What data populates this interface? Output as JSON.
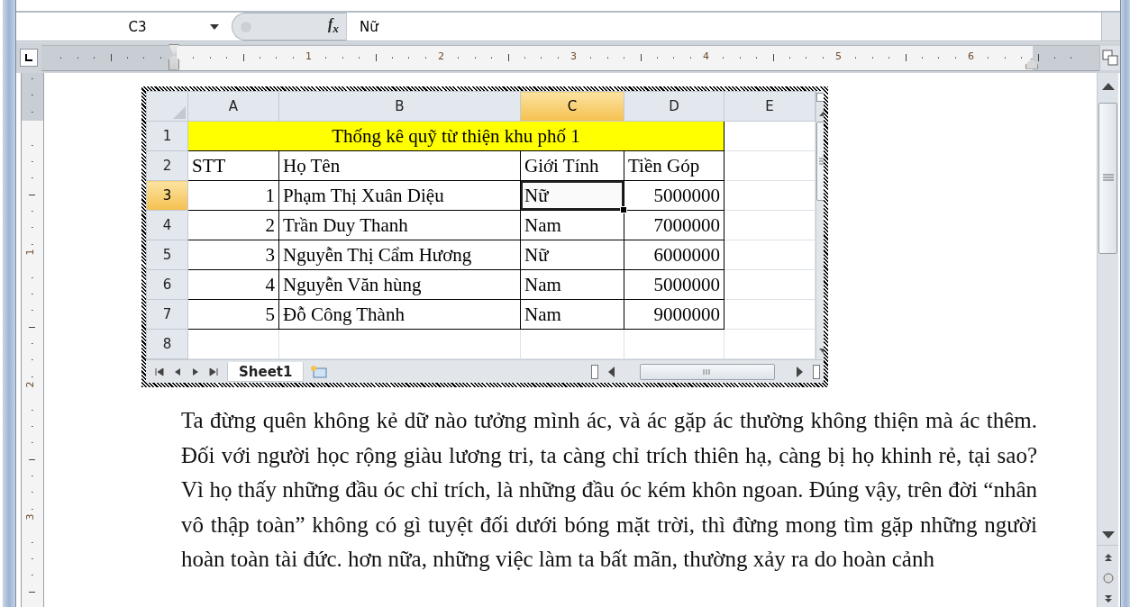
{
  "formula_bar": {
    "name_box": "C3",
    "function_label": "f$_{x}$",
    "value": "Nữ"
  },
  "ruler": {
    "horizontal_numbers": [
      "1",
      "2",
      "3",
      "4",
      "5",
      "6"
    ],
    "vertical_numbers": [
      "1",
      "2",
      "3"
    ]
  },
  "spreadsheet": {
    "columns": [
      {
        "label": "A",
        "selected": false
      },
      {
        "label": "B",
        "selected": false
      },
      {
        "label": "C",
        "selected": true
      },
      {
        "label": "D",
        "selected": false
      },
      {
        "label": "E",
        "selected": false
      }
    ],
    "rows": [
      {
        "header": "1",
        "selected": false,
        "kind": "title",
        "title": "Thống kê quỹ từ thiện khu phố 1"
      },
      {
        "header": "2",
        "selected": false,
        "kind": "data",
        "cells": [
          {
            "text": "STT",
            "right_aligned": false,
            "selected": false
          },
          {
            "text": "Họ Tên",
            "right_aligned": false,
            "selected": false
          },
          {
            "text": "Giới Tính",
            "right_aligned": false,
            "selected": false
          },
          {
            "text": "Tiền Góp",
            "right_aligned": false,
            "selected": false
          }
        ]
      },
      {
        "header": "3",
        "selected": true,
        "kind": "data",
        "cells": [
          {
            "text": "1",
            "right_aligned": true,
            "selected": false
          },
          {
            "text": "Phạm Thị Xuân Diệu",
            "right_aligned": false,
            "selected": false
          },
          {
            "text": "Nữ",
            "right_aligned": false,
            "selected": true
          },
          {
            "text": "5000000",
            "right_aligned": true,
            "selected": false
          }
        ]
      },
      {
        "header": "4",
        "selected": false,
        "kind": "data",
        "cells": [
          {
            "text": "2",
            "right_aligned": true,
            "selected": false
          },
          {
            "text": "Trần Duy Thanh",
            "right_aligned": false,
            "selected": false
          },
          {
            "text": "Nam",
            "right_aligned": false,
            "selected": false
          },
          {
            "text": "7000000",
            "right_aligned": true,
            "selected": false
          }
        ]
      },
      {
        "header": "5",
        "selected": false,
        "kind": "data",
        "cells": [
          {
            "text": "3",
            "right_aligned": true,
            "selected": false
          },
          {
            "text": "Nguyễn Thị Cẩm Hương",
            "right_aligned": false,
            "selected": false
          },
          {
            "text": "Nữ",
            "right_aligned": false,
            "selected": false
          },
          {
            "text": "6000000",
            "right_aligned": true,
            "selected": false
          }
        ]
      },
      {
        "header": "6",
        "selected": false,
        "kind": "data",
        "cells": [
          {
            "text": "4",
            "right_aligned": true,
            "selected": false
          },
          {
            "text": "Nguyễn Văn hùng",
            "right_aligned": false,
            "selected": false
          },
          {
            "text": "Nam",
            "right_aligned": false,
            "selected": false
          },
          {
            "text": "5000000",
            "right_aligned": true,
            "selected": false
          }
        ]
      },
      {
        "header": "7",
        "selected": false,
        "kind": "data",
        "cells": [
          {
            "text": "5",
            "right_aligned": true,
            "selected": false
          },
          {
            "text": "Đỗ Công Thành",
            "right_aligned": false,
            "selected": false
          },
          {
            "text": "Nam",
            "right_aligned": false,
            "selected": false
          },
          {
            "text": "9000000",
            "right_aligned": true,
            "selected": false
          }
        ]
      },
      {
        "header": "8",
        "selected": false,
        "kind": "empty"
      }
    ],
    "sheet_tabs": [
      {
        "label": "Sheet1",
        "selected": true
      }
    ]
  },
  "paragraph": "Ta đừng quên không kẻ dữ nào tưởng mình ác, và ác gặp ác thường không thiện mà ác thêm. Đối với người học rộng giàu lương tri, ta càng chỉ trích thiên hạ, càng bị họ khinh rẻ, tại sao? Vì họ thấy những đầu óc chỉ trích, là những đầu óc kém khôn ngoan. Đúng vậy, trên đời “nhân vô thập toàn” không có gì tuyệt đối dưới bóng mặt trời, thì đừng mong tìm gặp những người hoàn toàn tài đức. hơn nữa, những việc làm ta bất mãn, thường xảy ra do hoàn cảnh"
}
